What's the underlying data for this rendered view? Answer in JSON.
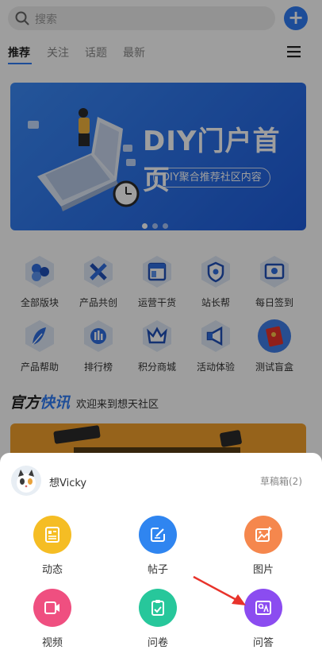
{
  "search": {
    "placeholder": "搜索"
  },
  "tabs": [
    {
      "label": "推荐"
    },
    {
      "label": "关注"
    },
    {
      "label": "话题"
    },
    {
      "label": "最新"
    }
  ],
  "banner": {
    "title": "DIY门户首页",
    "subtitle": "DIY聚合推荐社区内容"
  },
  "categories": [
    {
      "label": "全部版块",
      "icon": "blocks-icon"
    },
    {
      "label": "产品共创",
      "icon": "tools-icon"
    },
    {
      "label": "运营干货",
      "icon": "layout-icon"
    },
    {
      "label": "站长帮",
      "icon": "shield-icon"
    },
    {
      "label": "每日签到",
      "icon": "checkin-icon"
    },
    {
      "label": "产品帮助",
      "icon": "feather-icon"
    },
    {
      "label": "排行榜",
      "icon": "ranking-icon"
    },
    {
      "label": "积分商城",
      "icon": "crown-icon"
    },
    {
      "label": "活动体验",
      "icon": "megaphone-icon"
    },
    {
      "label": "测试盲盒",
      "icon": "envelope-icon"
    }
  ],
  "news": {
    "title_a": "官方",
    "title_b": "快讯",
    "welcome": "欢迎来到想天社区"
  },
  "sheet": {
    "user_name": "想Vicky",
    "drafts": "草稿箱(2)",
    "actions": [
      {
        "label": "动态",
        "color": "#f5bd24",
        "icon": "news-icon"
      },
      {
        "label": "帖子",
        "color": "#2f85f0",
        "icon": "edit-icon"
      },
      {
        "label": "图片",
        "color": "#f5874d",
        "icon": "image-icon"
      },
      {
        "label": "视频",
        "color": "#ef4f80",
        "icon": "video-icon"
      },
      {
        "label": "问卷",
        "color": "#27c79b",
        "icon": "clipboard-icon"
      },
      {
        "label": "问答",
        "color": "#8b4cf0",
        "icon": "qa-icon"
      }
    ]
  },
  "colors": {
    "accent": "#2f7cf6",
    "annotation_arrow": "#e8332b"
  }
}
